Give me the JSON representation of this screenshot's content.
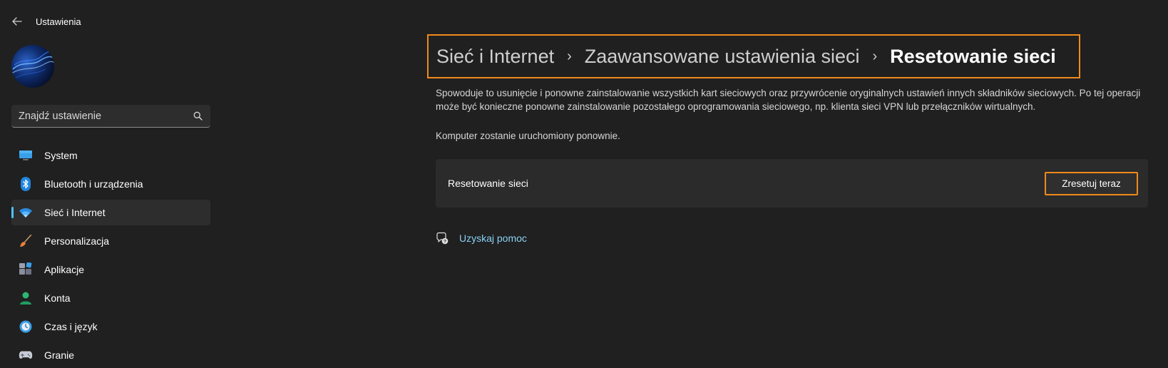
{
  "window": {
    "title": "Ustawienia"
  },
  "sidebar": {
    "search_placeholder": "Znajdź ustawienie",
    "items": [
      {
        "label": "System",
        "icon": "monitor-icon"
      },
      {
        "label": "Bluetooth i urządzenia",
        "icon": "bluetooth-icon"
      },
      {
        "label": "Sieć i Internet",
        "icon": "wifi-icon",
        "selected": true
      },
      {
        "label": "Personalizacja",
        "icon": "paintbrush-icon"
      },
      {
        "label": "Aplikacje",
        "icon": "apps-icon"
      },
      {
        "label": "Konta",
        "icon": "person-icon"
      },
      {
        "label": "Czas i język",
        "icon": "clock-globe-icon"
      },
      {
        "label": "Granie",
        "icon": "gamepad-icon"
      }
    ]
  },
  "main": {
    "breadcrumb": [
      "Sieć i Internet",
      "Zaawansowane ustawienia sieci",
      "Resetowanie sieci"
    ],
    "description": "Spowoduje to usunięcie i ponowne zainstalowanie wszystkich kart sieciowych oraz przywrócenie oryginalnych ustawień innych składników sieciowych. Po tej operacji może być konieczne ponowne zainstalowanie pozostałego oprogramowania sieciowego, np. klienta sieci VPN lub przełączników wirtualnych.",
    "restart_note": "Komputer zostanie uruchomiony ponownie.",
    "card": {
      "label": "Resetowanie sieci",
      "button_label": "Zresetuj teraz"
    },
    "help_link": "Uzyskaj pomoc"
  },
  "colors": {
    "background": "#202020",
    "accent": "#4cc2ff",
    "highlight_outline": "#f08a1c",
    "link": "#8ad2f4"
  }
}
